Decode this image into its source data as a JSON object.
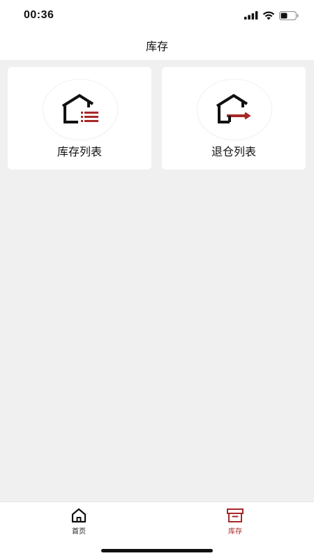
{
  "status_bar": {
    "time": "00:36"
  },
  "nav": {
    "title": "库存"
  },
  "cards": [
    {
      "label": "库存列表",
      "icon": "house-list-icon"
    },
    {
      "label": "退仓列表",
      "icon": "house-return-icon"
    }
  ],
  "tabs": [
    {
      "label": "首页",
      "icon": "home-icon",
      "active": false
    },
    {
      "label": "库存",
      "icon": "archive-box-icon",
      "active": true
    }
  ],
  "colors": {
    "accent": "#a82828",
    "background": "#f0f0f0",
    "card": "#ffffff",
    "text": "#111111"
  }
}
